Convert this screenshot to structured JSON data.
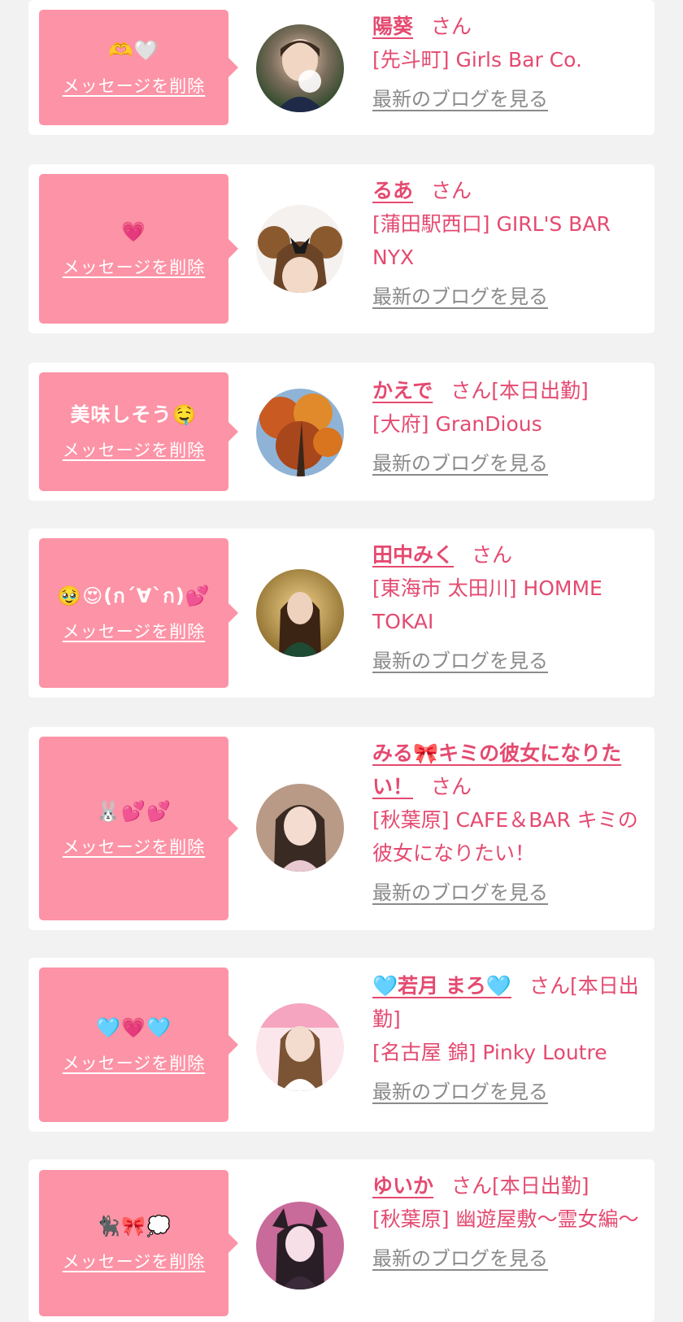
{
  "delete_label": "メッセージを削除",
  "san_label": "さん",
  "blog_label": "最新のブログを見る",
  "colors": {
    "accent": "#e44a70",
    "bubble": "#fd93a6",
    "background": "#f2f2f2",
    "link_gray": "#8a8a8a"
  },
  "items": [
    {
      "message": "🫶🤍",
      "name": "陽葵",
      "status": "",
      "shop": "[先斗町] Girls Bar Co."
    },
    {
      "message": "💗",
      "name": "るあ",
      "status": "",
      "shop": "[蒲田駅西口] GIRL'S BAR NYX"
    },
    {
      "message": "美味しそう🤤",
      "name": "かえで",
      "status": "[本日出勤]",
      "shop": "[大府] GranDious"
    },
    {
      "message": "🥹😍(ก´∀`ก)💕",
      "name": "田中みく",
      "status": "",
      "shop": "[東海市 太田川] HOMME TOKAI"
    },
    {
      "message": "🐰💕💕",
      "name": "みる🎀キミの彼女になりたい！",
      "status": "",
      "shop": "[秋葉原] CAFE＆BAR キミの彼女になりたい！"
    },
    {
      "message": "🩵💗🩵",
      "name": "🩵若月 まろ🩵",
      "status": "[本日出勤]",
      "shop": "[名古屋 錦] Pinky Loutre"
    },
    {
      "message": "🐈‍⬛🎀💭",
      "name": "ゆいか",
      "status": "[本日出勤]",
      "shop": "[秋葉原] 幽遊屋敷〜霊女編〜"
    }
  ]
}
